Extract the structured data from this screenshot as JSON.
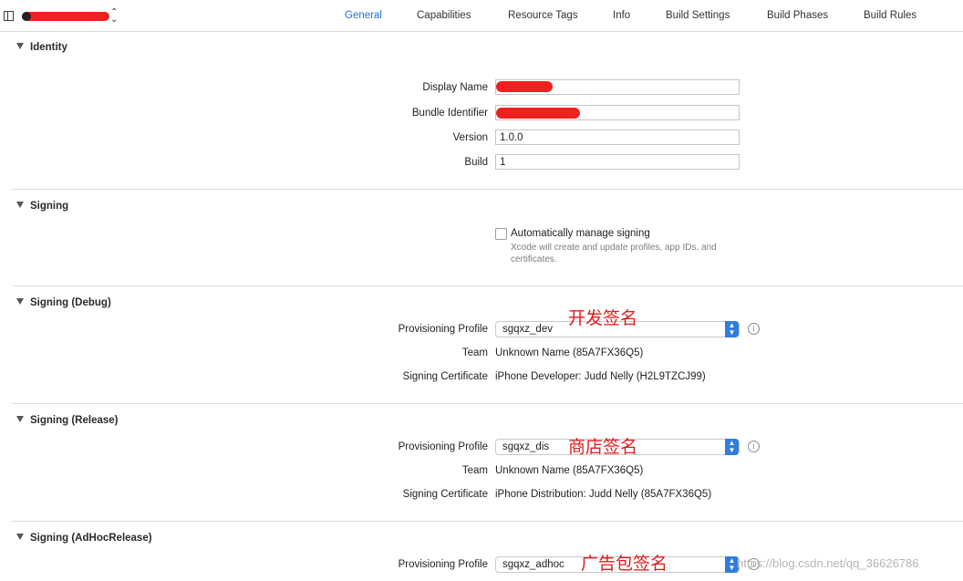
{
  "tabs": [
    "General",
    "Capabilities",
    "Resource Tags",
    "Info",
    "Build Settings",
    "Build Phases",
    "Build Rules"
  ],
  "identity": {
    "title": "Identity",
    "display_name_label": "Display Name",
    "bundle_identifier_label": "Bundle Identifier",
    "version_label": "Version",
    "version_value": "1.0.0",
    "build_label": "Build",
    "build_value": "1"
  },
  "signing": {
    "title": "Signing",
    "auto_label": "Automatically manage signing",
    "auto_note": "Xcode will create and update profiles, app IDs, and certificates."
  },
  "debug": {
    "title": "Signing (Debug)",
    "profile_label": "Provisioning Profile",
    "profile_value": "sgqxz_dev",
    "annotation": "开发签名",
    "team_label": "Team",
    "team_value": "Unknown Name (85A7FX36Q5)",
    "cert_label": "Signing Certificate",
    "cert_value": "iPhone Developer: Judd Nelly (H2L9TZCJ99)"
  },
  "release": {
    "title": "Signing (Release)",
    "profile_label": "Provisioning Profile",
    "profile_value": "sgqxz_dis",
    "annotation": "商店签名",
    "team_label": "Team",
    "team_value": "Unknown Name (85A7FX36Q5)",
    "cert_label": "Signing Certificate",
    "cert_value": "iPhone Distribution: Judd Nelly (85A7FX36Q5)"
  },
  "adhoc": {
    "title": "Signing (AdHocRelease)",
    "profile_label": "Provisioning Profile",
    "profile_value": "sgqxz_adhoc",
    "annotation": "广告包签名"
  },
  "watermark": "https://blog.csdn.net/qq_36626786"
}
